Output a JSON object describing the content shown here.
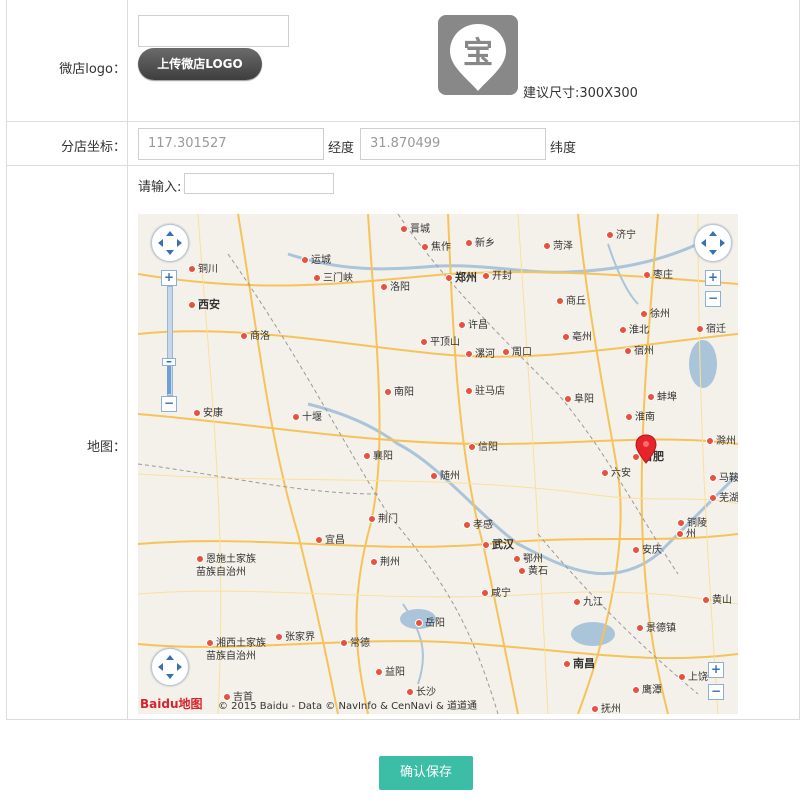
{
  "form": {
    "logo_label": "微店logo：",
    "upload_button": "上传微店LOGO",
    "logo_glyph": "宝",
    "logo_hint": "建议尺寸:300X300",
    "coord_label": "分店坐标：",
    "longitude_value": "117.301527",
    "longitude_label": "经度",
    "latitude_value": "31.870499",
    "latitude_label": "纬度",
    "map_label": "地图：",
    "search_label": "请输入:",
    "search_value": ""
  },
  "map": {
    "copyright": "© 2015 Baidu - Data © NavInfo & CenNavi & 道道通",
    "brand": "Baidu地图",
    "cities": [
      {
        "id": "jincheng",
        "name": "晋城"
      },
      {
        "id": "jiaozuo",
        "name": "焦作"
      },
      {
        "id": "xinxiang",
        "name": "新乡"
      },
      {
        "id": "heze",
        "name": "菏泽"
      },
      {
        "id": "jining",
        "name": "济宁"
      },
      {
        "id": "tongchuan",
        "name": "铜川"
      },
      {
        "id": "yuncheng",
        "name": "运城"
      },
      {
        "id": "sanmenxia",
        "name": "三门峡"
      },
      {
        "id": "zhengzhou",
        "name": "郑州"
      },
      {
        "id": "kaifeng",
        "name": "开封"
      },
      {
        "id": "zaozhuang",
        "name": "枣庄"
      },
      {
        "id": "xian",
        "name": "西安"
      },
      {
        "id": "luoyang",
        "name": "洛阳"
      },
      {
        "id": "shangqiu",
        "name": "商丘"
      },
      {
        "id": "xuzhou",
        "name": "徐州"
      },
      {
        "id": "shangluo",
        "name": "商洛"
      },
      {
        "id": "xuchang",
        "name": "许昌"
      },
      {
        "id": "huaibei",
        "name": "淮北"
      },
      {
        "id": "suqian",
        "name": "宿迁"
      },
      {
        "id": "pingdingshan",
        "name": "平顶山"
      },
      {
        "id": "luohe",
        "name": "漯河"
      },
      {
        "id": "zhoukou",
        "name": "周口"
      },
      {
        "id": "bozhou",
        "name": "亳州"
      },
      {
        "id": "suzhou",
        "name": "宿州"
      },
      {
        "id": "nanyang",
        "name": "南阳"
      },
      {
        "id": "zhumadian",
        "name": "驻马店"
      },
      {
        "id": "fuyang",
        "name": "阜阳"
      },
      {
        "id": "bengbu",
        "name": "蚌埠"
      },
      {
        "id": "ankang",
        "name": "安康"
      },
      {
        "id": "shiyan",
        "name": "十堰"
      },
      {
        "id": "huainan",
        "name": "淮南"
      },
      {
        "id": "xinyang",
        "name": "信阳"
      },
      {
        "id": "chuzhou",
        "name": "滁州"
      },
      {
        "id": "xiangyang",
        "name": "襄阳"
      },
      {
        "id": "suizhou",
        "name": "随州"
      },
      {
        "id": "luan",
        "name": "六安"
      },
      {
        "id": "hefei",
        "name": "合肥"
      },
      {
        "id": "maanshan",
        "name": "马鞍"
      },
      {
        "id": "wuhu",
        "name": "芜湖"
      },
      {
        "id": "jingmen",
        "name": "荆门"
      },
      {
        "id": "xiaogan",
        "name": "孝感"
      },
      {
        "id": "tongling",
        "name": "铜陵"
      },
      {
        "id": "yichang",
        "name": "宜昌"
      },
      {
        "id": "wuhan",
        "name": "武汉"
      },
      {
        "id": "ezhou",
        "name": "鄂州"
      },
      {
        "id": "enshi",
        "name": "恩施土家族\n苗族自治州"
      },
      {
        "id": "jingzhou",
        "name": "荆州"
      },
      {
        "id": "huangshi",
        "name": "黄石"
      },
      {
        "id": "anqing",
        "name": "安庆"
      },
      {
        "id": "xianning",
        "name": "咸宁"
      },
      {
        "id": "jiujiang",
        "name": "九江"
      },
      {
        "id": "huangshan",
        "name": "黄山"
      },
      {
        "id": "xiangxi",
        "name": "湘西土家族\n苗族自治州"
      },
      {
        "id": "zhangjiajie",
        "name": "张家界"
      },
      {
        "id": "changde",
        "name": "常德"
      },
      {
        "id": "yueyang",
        "name": "岳阳"
      },
      {
        "id": "jingdezhen",
        "name": "景德镇"
      },
      {
        "id": "yiyang",
        "name": "益阳"
      },
      {
        "id": "nanchang",
        "name": "南昌"
      },
      {
        "id": "shangrao",
        "name": "上饶"
      },
      {
        "id": "changsha",
        "name": "长沙"
      },
      {
        "id": "yingtan",
        "name": "鹰潭"
      },
      {
        "id": "jishou",
        "name": "吉首"
      },
      {
        "id": "fuzhou",
        "name": "抚州"
      },
      {
        "id": "chizhou",
        "name": "州"
      }
    ]
  },
  "footer": {
    "save_button": "确认保存"
  }
}
